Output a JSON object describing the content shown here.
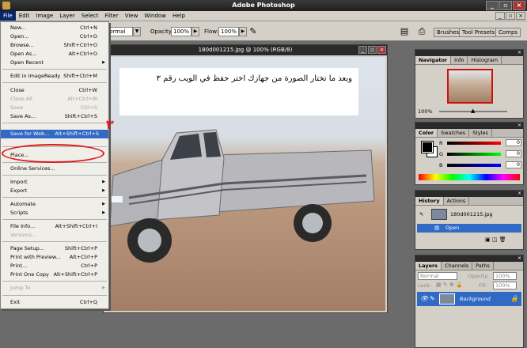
{
  "app": {
    "title": "Adobe Photoshop"
  },
  "menubar": [
    "File",
    "Edit",
    "Image",
    "Layer",
    "Select",
    "Filter",
    "View",
    "Window",
    "Help"
  ],
  "options": {
    "mode_value": "Normal",
    "opacity_label": "Opacity:",
    "opacity_value": "100%",
    "flow_label": "Flow:",
    "flow_value": "100%",
    "wells": [
      "Brushes",
      "Tool Presets",
      "Comps"
    ]
  },
  "document": {
    "title": "180d001215.jpg @ 100% (RGB/8)",
    "caption": "وبعد ما تختار الصورة من جهازك اختر حفظ في الويب رقم ٣"
  },
  "file_menu": {
    "items": [
      {
        "label": "New...",
        "shortcut": "Ctrl+N"
      },
      {
        "label": "Open...",
        "shortcut": "Ctrl+O"
      },
      {
        "label": "Browse...",
        "shortcut": "Shift+Ctrl+O"
      },
      {
        "label": "Open As...",
        "shortcut": "Alt+Ctrl+O"
      },
      {
        "label": "Open Recent",
        "shortcut": ""
      },
      {
        "label": "Edit in ImageReady",
        "shortcut": "Shift+Ctrl+M"
      },
      {
        "label": "Close",
        "shortcut": "Ctrl+W"
      },
      {
        "label": "Close All",
        "shortcut": "Alt+Ctrl+W"
      },
      {
        "label": "Save",
        "shortcut": "Ctrl+S"
      },
      {
        "label": "Save As...",
        "shortcut": "Shift+Ctrl+S"
      },
      {
        "label": "Save for Web...",
        "shortcut": "Alt+Shift+Ctrl+S"
      },
      {
        "label": "Place...",
        "shortcut": ""
      },
      {
        "label": "Online Services...",
        "shortcut": ""
      },
      {
        "label": "Import",
        "shortcut": ""
      },
      {
        "label": "Export",
        "shortcut": ""
      },
      {
        "label": "Automate",
        "shortcut": ""
      },
      {
        "label": "Scripts",
        "shortcut": ""
      },
      {
        "label": "File Info...",
        "shortcut": "Alt+Shift+Ctrl+I"
      },
      {
        "label": "Versions...",
        "shortcut": ""
      },
      {
        "label": "Page Setup...",
        "shortcut": "Shift+Ctrl+P"
      },
      {
        "label": "Print with Preview...",
        "shortcut": "Alt+Ctrl+P"
      },
      {
        "label": "Print...",
        "shortcut": "Ctrl+P"
      },
      {
        "label": "Print One Copy",
        "shortcut": "Alt+Shift+Ctrl+P"
      },
      {
        "label": "Jump To",
        "shortcut": ""
      },
      {
        "label": "Exit",
        "shortcut": "Ctrl+Q"
      }
    ],
    "annotation_number": "٣"
  },
  "navigator": {
    "tabs": [
      "Navigator",
      "Info",
      "Histogram"
    ],
    "zoom": "100%"
  },
  "color": {
    "tabs": [
      "Color",
      "Swatches",
      "Styles"
    ],
    "channels": [
      {
        "name": "R",
        "value": "0"
      },
      {
        "name": "G",
        "value": "0"
      },
      {
        "name": "B",
        "value": "0"
      }
    ]
  },
  "history": {
    "tabs": [
      "History",
      "Actions"
    ],
    "snapshot": "180d001215.jpg",
    "step": "Open"
  },
  "layers": {
    "tabs": [
      "Layers",
      "Channels",
      "Paths"
    ],
    "blend_mode": "Normal",
    "opacity_label": "Opacity:",
    "opacity_value": "100%",
    "lock_label": "Lock:",
    "fill_label": "Fill:",
    "fill_value": "100%",
    "layer_name": "Background"
  },
  "colors": {
    "highlight": "#316ac5",
    "annotation_red": "#e01818",
    "chrome": "#d4d0c8"
  }
}
